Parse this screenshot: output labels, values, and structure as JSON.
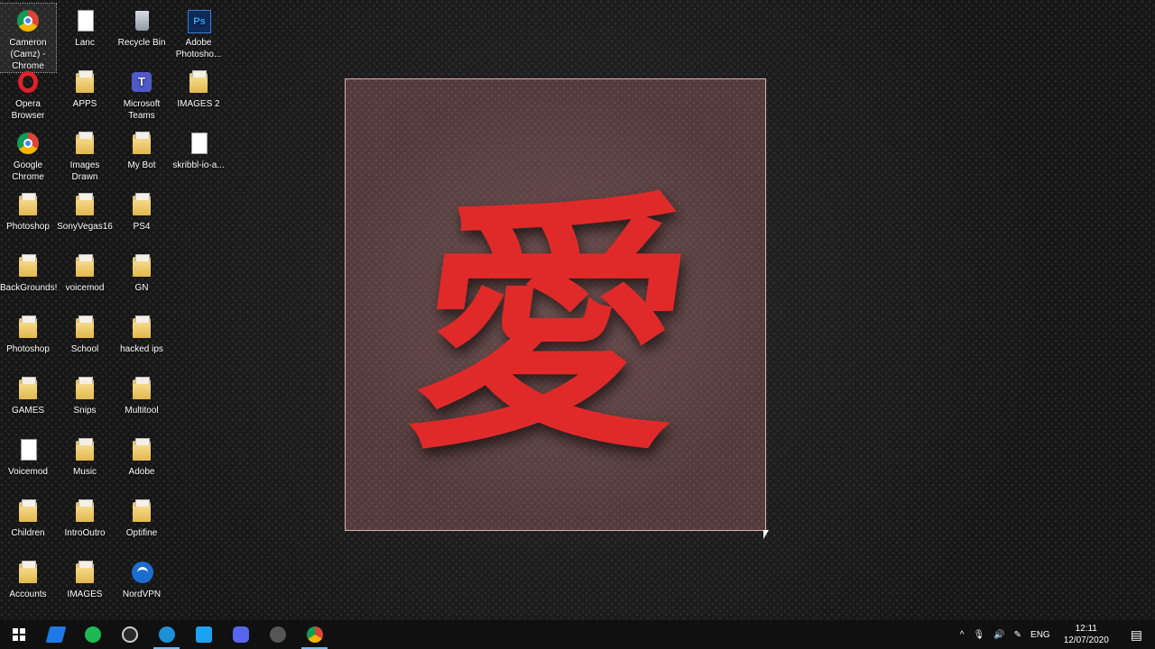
{
  "desktop": {
    "icons": [
      {
        "label": "Cameron\n(Camz) -\nChrome",
        "type": "chrome"
      },
      {
        "label": "Lanc",
        "type": "doc"
      },
      {
        "label": "Recycle Bin",
        "type": "recycle"
      },
      {
        "label": "Adobe\nPhotosho...",
        "type": "ps"
      },
      {
        "label": "Opera\nBrowser",
        "type": "opera"
      },
      {
        "label": "APPS",
        "type": "folder"
      },
      {
        "label": "Microsoft\nTeams",
        "type": "teams"
      },
      {
        "label": "IMAGES 2",
        "type": "folder"
      },
      {
        "label": "Google\nChrome",
        "type": "chrome"
      },
      {
        "label": "Images\nDrawn",
        "type": "folder"
      },
      {
        "label": "My Bot",
        "type": "folder"
      },
      {
        "label": "skribbl-io-a...",
        "type": "doc"
      },
      {
        "label": "Photoshop",
        "type": "folder"
      },
      {
        "label": "SonyVegas16",
        "type": "folder"
      },
      {
        "label": "PS4",
        "type": "folder"
      },
      {
        "label": "BackGrounds!",
        "type": "folder"
      },
      {
        "label": "voicemod",
        "type": "folder"
      },
      {
        "label": "GN",
        "type": "folder"
      },
      {
        "label": "Photoshop",
        "type": "folder"
      },
      {
        "label": "School",
        "type": "folder"
      },
      {
        "label": "hacked ips",
        "type": "folder"
      },
      {
        "label": "GAMES",
        "type": "folder"
      },
      {
        "label": "Snips",
        "type": "folder"
      },
      {
        "label": "Multitool",
        "type": "folder"
      },
      {
        "label": "Voicemod",
        "type": "voicemod"
      },
      {
        "label": "Music",
        "type": "folder"
      },
      {
        "label": "Adobe",
        "type": "folder"
      },
      {
        "label": "Children",
        "type": "folder"
      },
      {
        "label": "IntroOutro",
        "type": "folder"
      },
      {
        "label": "Optifine",
        "type": "folder"
      },
      {
        "label": "Accounts",
        "type": "folder"
      },
      {
        "label": "IMAGES",
        "type": "folder"
      },
      {
        "label": "NordVPN",
        "type": "nord"
      }
    ],
    "wallpaper_char": "愛"
  },
  "taskbar": {
    "apps": [
      {
        "name": "start",
        "icon": "windows-logo"
      },
      {
        "name": "app",
        "icon": "blue-wing-icon",
        "color": "#1e78e6"
      },
      {
        "name": "spotify",
        "icon": "spotify-icon",
        "color": "#1db954"
      },
      {
        "name": "app",
        "icon": "obs-icon",
        "color": "#2a2a2a"
      },
      {
        "name": "app",
        "icon": "blue-circle-icon",
        "color": "#1e90d6"
      },
      {
        "name": "twitter",
        "icon": "twitter-icon",
        "color": "#1da1f2"
      },
      {
        "name": "discord",
        "icon": "discord-icon",
        "color": "#5865f2"
      },
      {
        "name": "app",
        "icon": "gray-circle-icon",
        "color": "#555555"
      },
      {
        "name": "chrome",
        "icon": "chrome-icon",
        "color": "#db4437"
      }
    ],
    "tray": {
      "chevron": "^",
      "mic": "🎙",
      "volume": "🔊",
      "pen": "✎",
      "language": "ENG",
      "time": "12:11",
      "date": "12/07/2020",
      "notifications": "▤"
    }
  }
}
